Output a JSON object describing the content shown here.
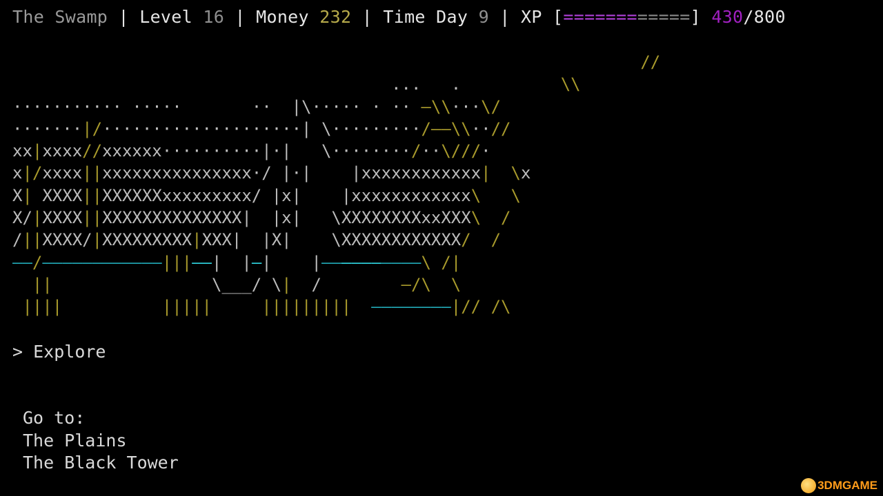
{
  "status": {
    "location": "The Swamp",
    "sep": " | ",
    "level_label": "Level",
    "level_value": "16",
    "money_label": "Money",
    "money_value": "232",
    "time_label": "Time",
    "day_label": "Day",
    "day_value": "9",
    "xp_label": "XP",
    "xp_open": "[",
    "xp_bar_filled": "=======",
    "xp_bar_empty": "=====",
    "xp_close": "]",
    "xp_current": "430",
    "xp_slash": "/",
    "xp_max": "800",
    "xp_progress": 0.5375
  },
  "art": {
    "lines": [
      [
        [
          "                                                               ",
          "w"
        ],
        [
          "//",
          "y"
        ]
      ],
      [
        [
          "                                      ...   .          ",
          "w"
        ],
        [
          "\\\\",
          "y"
        ]
      ],
      [
        [
          "··········· ·····       ··  |\\····· · ·· ",
          "w"
        ],
        [
          "—\\\\",
          "y"
        ],
        [
          "···",
          "w"
        ],
        [
          "\\/",
          "y"
        ]
      ],
      [
        [
          "·······",
          "w"
        ],
        [
          "|/",
          "y"
        ],
        [
          "····················|",
          "w"
        ],
        [
          " \\·········",
          "w"
        ],
        [
          "/——\\\\",
          "y"
        ],
        [
          "··",
          "w"
        ],
        [
          "//",
          "y"
        ]
      ],
      [
        [
          "xx",
          "w"
        ],
        [
          "|",
          "y"
        ],
        [
          "xxxx",
          "w"
        ],
        [
          "//",
          "y"
        ],
        [
          "xxxxxx··········|·|",
          "w"
        ],
        [
          "   \\········",
          "w"
        ],
        [
          "/",
          "y"
        ],
        [
          "··",
          "w"
        ],
        [
          "\\///",
          "y"
        ],
        [
          "·",
          "w"
        ]
      ],
      [
        [
          "x",
          "w"
        ],
        [
          "|/",
          "y"
        ],
        [
          "xxxx",
          "w"
        ],
        [
          "||",
          "y"
        ],
        [
          "xxxxxxxxxxxxxxx·/",
          "w"
        ],
        [
          " |·|    |",
          "w"
        ],
        [
          "xxxxxxxxxxxx",
          "w"
        ],
        [
          "|",
          "y"
        ],
        [
          "  \\",
          "y"
        ],
        [
          "x",
          "w"
        ]
      ],
      [
        [
          "X",
          "w"
        ],
        [
          "|",
          "y"
        ],
        [
          " XXXX",
          "w"
        ],
        [
          "|",
          "y"
        ],
        [
          "|",
          "y"
        ],
        [
          "XXXXXXxxxxxxxxx/",
          "w"
        ],
        [
          " |x|    |",
          "w"
        ],
        [
          "xxxxxxxxxxxx",
          "w"
        ],
        [
          "\\",
          "y"
        ],
        [
          "   \\",
          "y"
        ]
      ],
      [
        [
          "X/",
          "w"
        ],
        [
          "|",
          "y"
        ],
        [
          "XXXX",
          "w"
        ],
        [
          "|",
          "y"
        ],
        [
          "|",
          "y"
        ],
        [
          "XXXXXXXXXXXXXX|",
          "w"
        ],
        [
          "  |x|   \\XXXXXXXXxxXXX",
          "w"
        ],
        [
          "\\",
          "y"
        ],
        [
          "  /",
          "y"
        ]
      ],
      [
        [
          "/",
          "w"
        ],
        [
          "|",
          "y"
        ],
        [
          "|",
          "y"
        ],
        [
          "XXXX/",
          "w"
        ],
        [
          "|",
          "y"
        ],
        [
          "XXXXXXXXX",
          "w"
        ],
        [
          "|",
          "y"
        ],
        [
          "XXX|",
          "w"
        ],
        [
          "  |X|    \\XXXXXXXXXXXX",
          "w"
        ],
        [
          "/",
          "y"
        ],
        [
          "  /",
          "y"
        ]
      ],
      [
        [
          "——",
          "c"
        ],
        [
          "/",
          "y"
        ],
        [
          "————————————",
          "c"
        ],
        [
          "|||",
          "y"
        ],
        [
          "——",
          "cb"
        ],
        [
          "|",
          "w"
        ],
        [
          "  |",
          "w"
        ],
        [
          "—",
          "cb"
        ],
        [
          "|",
          "w"
        ],
        [
          "    |",
          "w"
        ],
        [
          "——",
          "c"
        ],
        [
          "————",
          "cb"
        ],
        [
          "————",
          "c"
        ],
        [
          "\\",
          "y"
        ],
        [
          " /|",
          "y"
        ]
      ],
      [
        [
          "  ||              ",
          "y"
        ],
        [
          "  \\___/ \\",
          "w"
        ],
        [
          "|",
          "y"
        ],
        [
          "  /",
          "w"
        ],
        [
          "        —/\\  \\",
          "y"
        ]
      ],
      [
        [
          " ||||          |||||     |||||||||  ",
          "y"
        ],
        [
          "————————",
          "c"
        ],
        [
          "|// /\\",
          "y"
        ]
      ]
    ]
  },
  "prompt": {
    "caret": ">",
    "action": "Explore"
  },
  "menu": {
    "header": "Go to:",
    "destinations": [
      "The Plains",
      "The Black Tower"
    ]
  },
  "watermark": {
    "text": "3DMGAME",
    "icon": "watermark-logo-icon"
  },
  "colors": {
    "background": "#000000",
    "ascii_white": "#bdbdbd",
    "ascii_yellow": "#a89a2c",
    "ascii_cyan": "#21a7b5",
    "money": "#b5a94a",
    "xp": "#a020c0"
  }
}
